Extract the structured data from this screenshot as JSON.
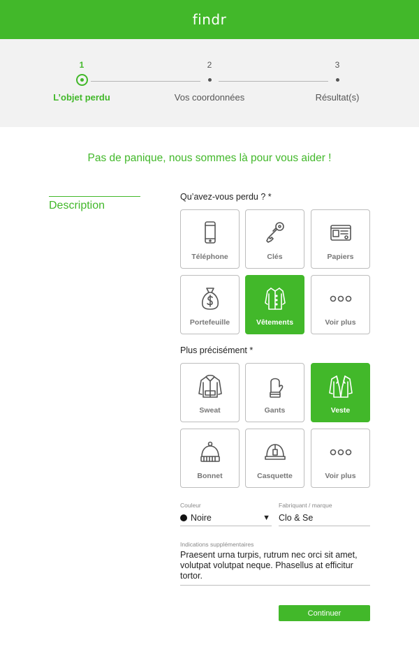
{
  "header": {
    "logo": "findr"
  },
  "stepper": {
    "steps": [
      {
        "number": "1",
        "label": "L’objet perdu"
      },
      {
        "number": "2",
        "label": "Vos coordonnées"
      },
      {
        "number": "3",
        "label": "Résultat(s)"
      }
    ],
    "active_step": 1
  },
  "tagline": "Pas de panique, nous sommes là pour vous aider !",
  "sidebar": {
    "title": "Description"
  },
  "lost_item": {
    "question": "Qu’avez-vous perdu ? *",
    "options": [
      {
        "label": "Téléphone",
        "icon": "phone-icon",
        "selected": false
      },
      {
        "label": "Clés",
        "icon": "key-icon",
        "selected": false
      },
      {
        "label": "Papiers",
        "icon": "id-card-icon",
        "selected": false
      },
      {
        "label": "Portefeuille",
        "icon": "money-bag-icon",
        "selected": false
      },
      {
        "label": "Vêtements",
        "icon": "shirt-icon",
        "selected": true
      },
      {
        "label": "Voir plus",
        "icon": "more-icon",
        "selected": false
      }
    ]
  },
  "precise_item": {
    "question": "Plus précisément *",
    "options": [
      {
        "label": "Sweat",
        "icon": "sweatshirt-icon",
        "selected": false
      },
      {
        "label": "Gants",
        "icon": "glove-icon",
        "selected": false
      },
      {
        "label": "Veste",
        "icon": "jacket-icon",
        "selected": true
      },
      {
        "label": "Bonnet",
        "icon": "beanie-icon",
        "selected": false
      },
      {
        "label": "Casquette",
        "icon": "cap-icon",
        "selected": false
      },
      {
        "label": "Voir plus",
        "icon": "more-icon",
        "selected": false
      }
    ]
  },
  "form": {
    "color_label": "Couleur",
    "color_value": "Noire",
    "color_swatch": "#111111",
    "brand_label": "Fabriquant / marque",
    "brand_value": "Clo & Se",
    "notes_label": "Indications supplémentaires",
    "notes_value": "Praesent urna turpis, rutrum nec orci sit amet, volutpat volutpat neque. Phasellus at efficitur tortor."
  },
  "continue_button": "Continuer",
  "colors": {
    "brand_green": "#42b82a",
    "stepper_bg": "#f2f2f2"
  }
}
